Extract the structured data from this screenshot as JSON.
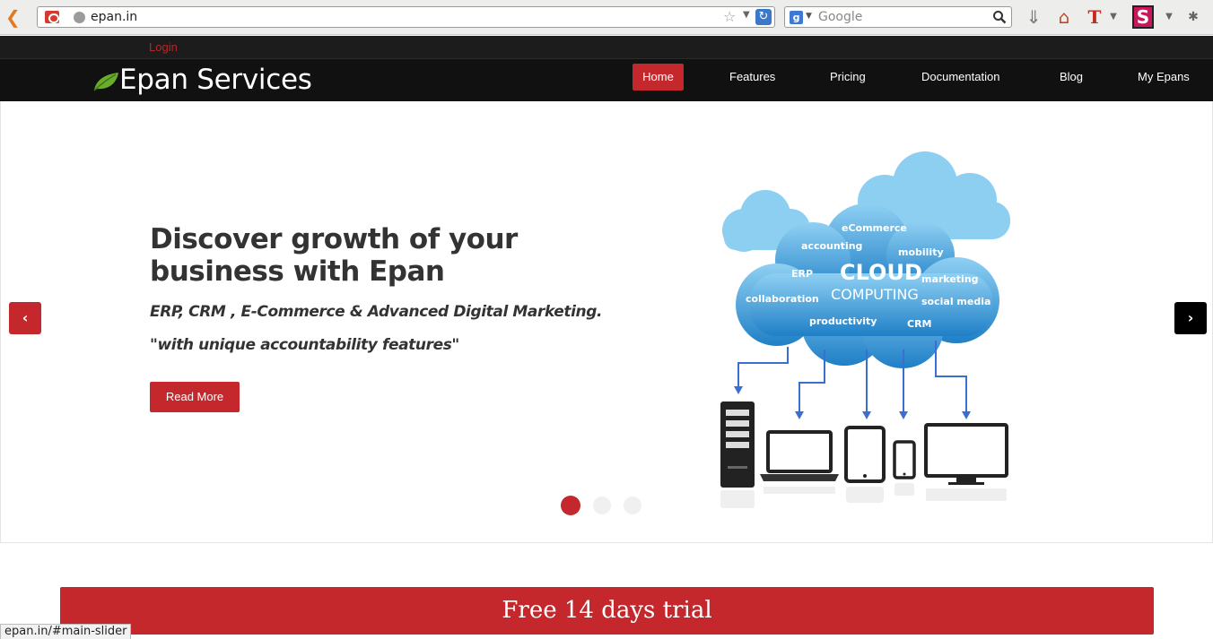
{
  "browser": {
    "url": "epan.in",
    "search_placeholder": "Google",
    "status_url": "epan.in/#main-slider"
  },
  "site": {
    "login_label": "Login",
    "brand": "Epan Services",
    "nav": [
      {
        "label": "Home",
        "active": true
      },
      {
        "label": "Features"
      },
      {
        "label": "Pricing"
      },
      {
        "label": "Documentation"
      },
      {
        "label": "Blog"
      },
      {
        "label": "My Epans"
      }
    ]
  },
  "hero": {
    "headline": "Discover growth of your business with Epan",
    "subline": "ERP, CRM , E-Commerce & Advanced Digital Marketing.",
    "quote": "\"with unique accountability features\"",
    "read_more": "Read More",
    "prev_label": "‹",
    "next_label": "›",
    "slide_count": 3,
    "active_slide": 1,
    "cloud": {
      "title": "CLOUD",
      "subtitle": "COMPUTING",
      "terms": [
        "eCommerce",
        "accounting",
        "mobility",
        "ERP",
        "marketing",
        "collaboration",
        "social media",
        "productivity",
        "CRM"
      ]
    }
  },
  "cta": {
    "label": "Free 14 days trial"
  },
  "colors": {
    "accent": "#c4282c",
    "nav_bg": "#111111",
    "cloud_blue": "#3a9ad9",
    "arrow_blue": "#3b6fcf"
  }
}
